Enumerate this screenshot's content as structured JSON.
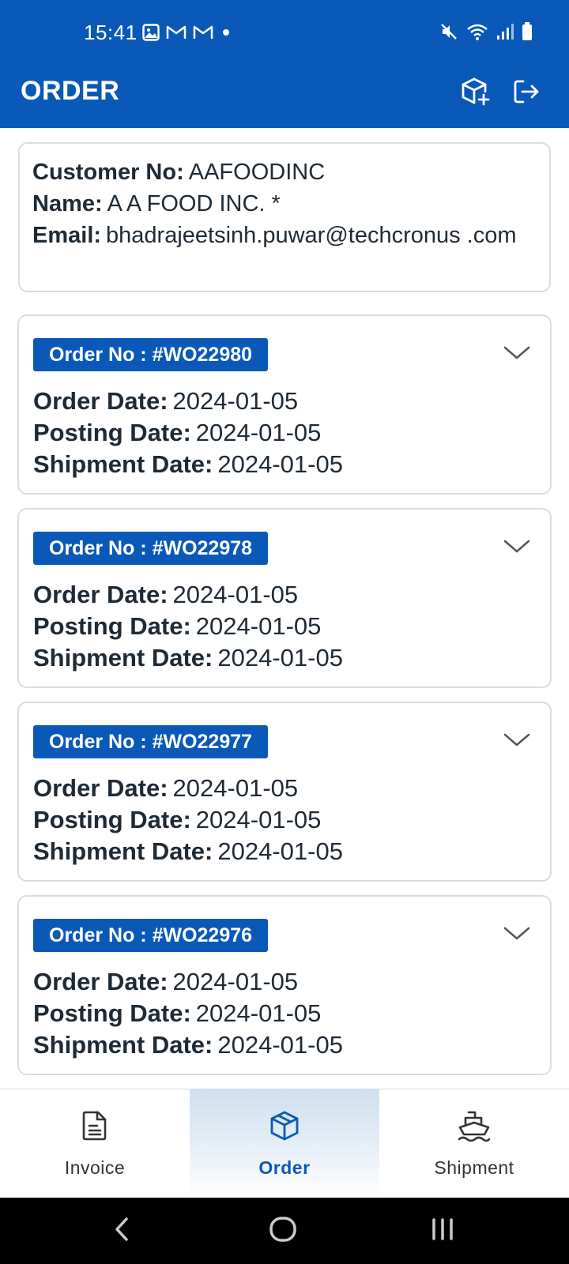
{
  "status_bar": {
    "time": "15:41",
    "left_icons": [
      "gallery-icon",
      "gmail-icon",
      "gmail-icon",
      "dot-icon"
    ],
    "right_icons": [
      "mute-icon",
      "wifi-icon",
      "signal-icon",
      "battery-icon"
    ]
  },
  "header": {
    "title": "ORDER",
    "actions": [
      "box-add-icon",
      "logout-icon"
    ]
  },
  "customer": {
    "customer_no_label": "Customer No:",
    "customer_no": "AAFOODINC",
    "name_label": "Name:",
    "name": "A A FOOD INC. *",
    "email_label": "Email:",
    "email": "bhadrajeetsinh.puwar@techcronus .com"
  },
  "labels": {
    "order_date": "Order Date:",
    "posting_date": "Posting Date:",
    "shipment_date": "Shipment Date:"
  },
  "orders": [
    {
      "badge": "Order No : #WO22980",
      "order_date": "2024-01-05",
      "posting_date": "2024-01-05",
      "shipment_date": "2024-01-05"
    },
    {
      "badge": "Order No : #WO22978",
      "order_date": "2024-01-05",
      "posting_date": "2024-01-05",
      "shipment_date": "2024-01-05"
    },
    {
      "badge": "Order No : #WO22977",
      "order_date": "2024-01-05",
      "posting_date": "2024-01-05",
      "shipment_date": "2024-01-05"
    },
    {
      "badge": "Order No : #WO22976",
      "order_date": "2024-01-05",
      "posting_date": "2024-01-05",
      "shipment_date": "2024-01-05"
    }
  ],
  "bottom_nav": {
    "tabs": [
      {
        "label": "Invoice",
        "icon": "invoice-icon"
      },
      {
        "label": "Order",
        "icon": "box-icon",
        "active": true
      },
      {
        "label": "Shipment",
        "icon": "ship-icon"
      }
    ]
  },
  "colors": {
    "primary": "#0a59b8",
    "text": "#1e2a36",
    "border": "#d9dde2",
    "active_tab_bg": "#cfe0ef"
  }
}
